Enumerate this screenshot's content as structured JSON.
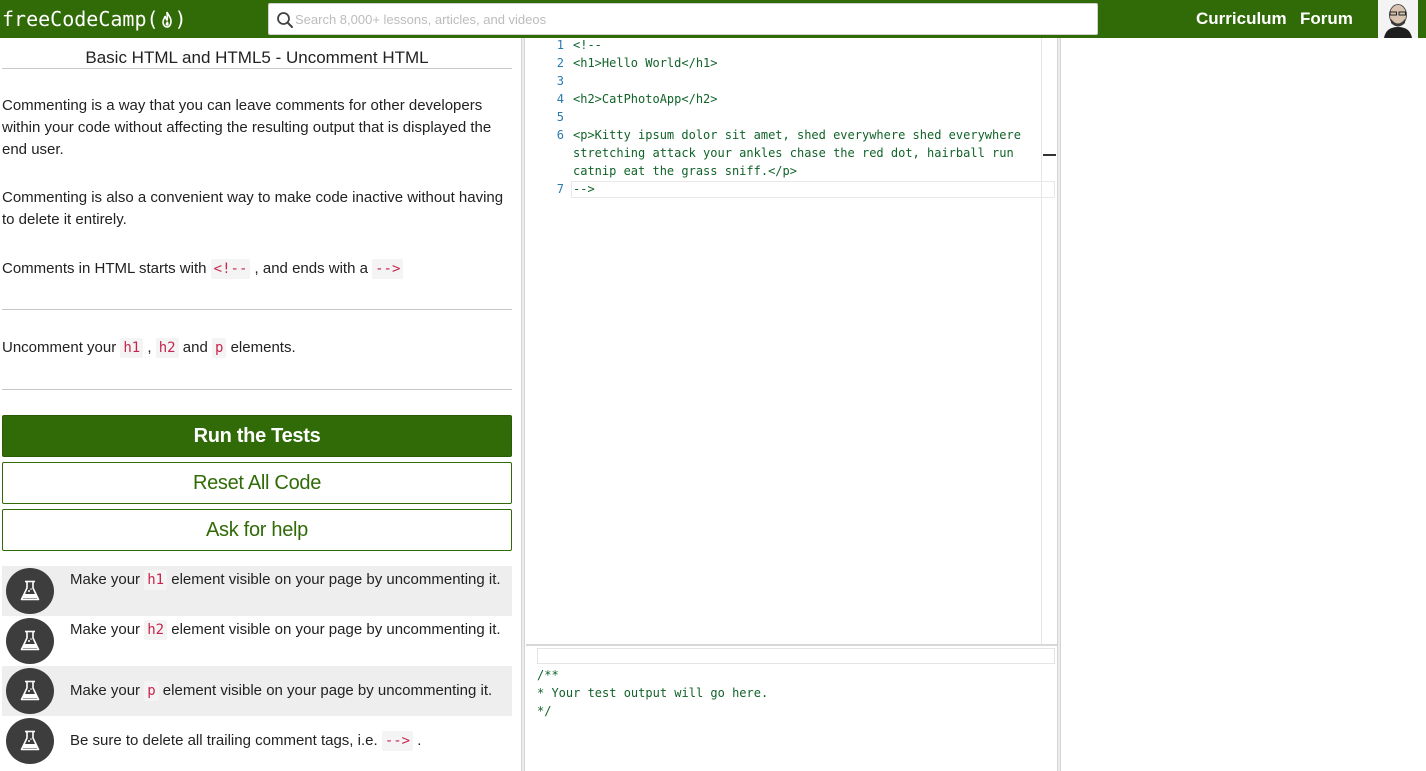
{
  "navbar": {
    "brand_prefix": "freeCodeCamp(",
    "brand_suffix": ")",
    "search_placeholder": "Search 8,000+ lessons, articles, and videos",
    "links": [
      "Curriculum",
      "Forum"
    ]
  },
  "challenge": {
    "title": "Basic HTML and HTML5 - Uncomment HTML",
    "paragraph_1": "Commenting is a way that you can leave comments for other developers within your code without affecting the resulting output that is displayed the end user.",
    "paragraph_2": "Commenting is also a convenient way to make code inactive without having to delete it entirely.",
    "paragraph_3_pre": "Comments in HTML starts with ",
    "paragraph_3_code_1": "<!--",
    "paragraph_3_mid": " , and ends with a ",
    "paragraph_3_code_2": "-->",
    "instructions_pre": "Uncomment your ",
    "instructions_code_1": "h1",
    "instructions_sep": " , ",
    "instructions_code_2": "h2",
    "instructions_and": " and ",
    "instructions_code_3": "p",
    "instructions_post": " elements."
  },
  "buttons": {
    "run": "Run the Tests",
    "reset": "Reset All Code",
    "help": "Ask for help"
  },
  "tests": [
    {
      "pre": "Make your ",
      "code": "h1",
      "post": " element visible on your page by uncommenting it."
    },
    {
      "pre": "Make your ",
      "code": "h2",
      "post": " element visible on your page by uncommenting it."
    },
    {
      "pre": "Make your ",
      "code": "p",
      "post": " element visible on your page by uncommenting it."
    },
    {
      "pre": "Be sure to delete all trailing comment tags, i.e. ",
      "code": "-->",
      "post": " ."
    }
  ],
  "editor": {
    "line_numbers": [
      "1",
      "2",
      "3",
      "4",
      "5",
      "6",
      "7"
    ],
    "lines": [
      "<!--",
      "<h1>Hello World</h1>",
      "",
      "<h2>CatPhotoApp</h2>",
      "",
      "<p>Kitty ipsum dolor sit amet, shed everywhere shed everywhere",
      "stretching attack your ankles chase the red dot, hairball run",
      "catnip eat the grass sniff.</p>",
      "-->"
    ]
  },
  "output": {
    "lines": [
      "/**",
      "* Your test output will go here.",
      "*/"
    ]
  },
  "colors": {
    "brand_green": "#306b08",
    "code_red": "#c7254e",
    "code_green": "#116329",
    "gutter_blue": "#2a7ab0"
  }
}
